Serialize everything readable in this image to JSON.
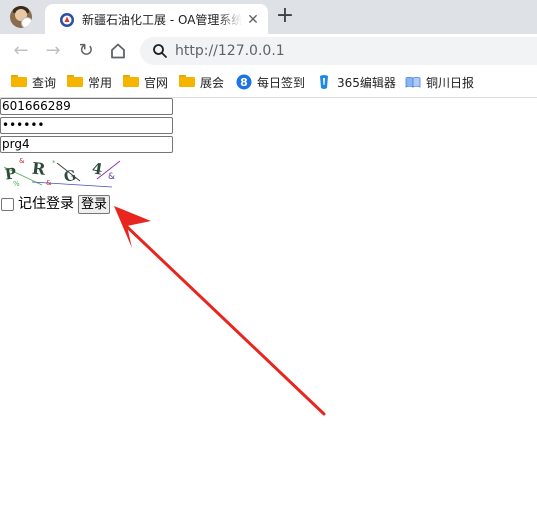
{
  "browser": {
    "tab": {
      "title": "新疆石油化工展 - OA管理系统",
      "close_glyph": "✕"
    },
    "new_tab_glyph": "+",
    "nav": {
      "back_glyph": "←",
      "forward_glyph": "→",
      "reload_glyph": "↻",
      "home_icon": "home-icon"
    },
    "address": {
      "url": "http://127.0.0.1"
    },
    "bookmarks": [
      {
        "label": "查询",
        "icon": "folder-icon"
      },
      {
        "label": "常用",
        "icon": "folder-icon"
      },
      {
        "label": "官网",
        "icon": "folder-icon"
      },
      {
        "label": "展会",
        "icon": "folder-icon"
      },
      {
        "label": "每日签到",
        "icon": "checkin-icon"
      },
      {
        "label": "365编辑器",
        "icon": "editor-icon"
      },
      {
        "label": "铜川日报",
        "icon": "book-icon"
      }
    ]
  },
  "login_form": {
    "username": "601666289",
    "password": "••••••",
    "captcha_input": "prg4",
    "captcha_image_text": "PRG4",
    "remember_label": "记住登录",
    "remember_checked": false,
    "submit_label": "登录"
  },
  "annotation": {
    "arrow_color": "#e8261f"
  }
}
